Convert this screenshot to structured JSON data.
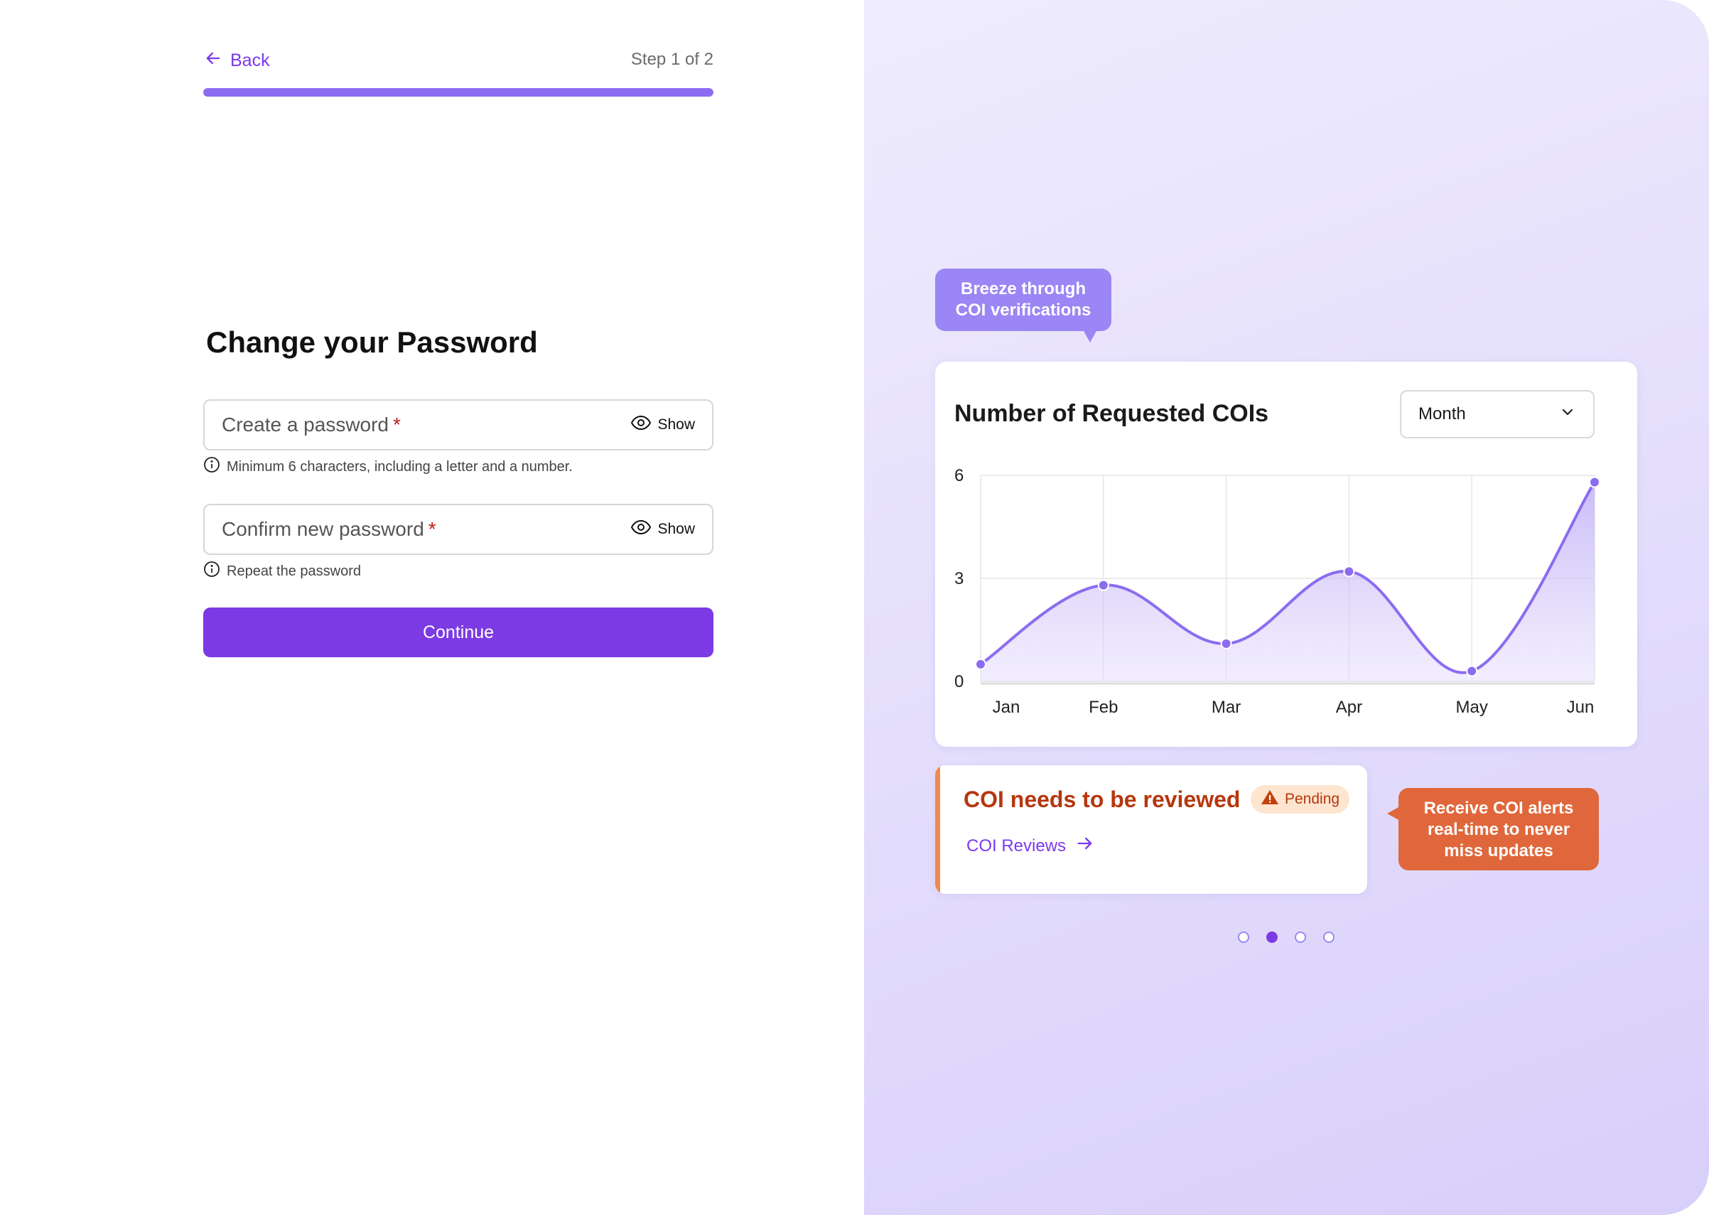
{
  "nav": {
    "back_label": "Back",
    "step_label": "Step 1 of 2",
    "progress": 1.0
  },
  "form": {
    "title": "Change your Password",
    "password_placeholder": "Create a password",
    "password_hint": "Minimum 6 characters, including a letter and a number.",
    "confirm_placeholder": "Confirm new password",
    "confirm_hint": "Repeat the password",
    "required_mark": "*",
    "show_label": "Show",
    "continue_label": "Continue"
  },
  "promo": {
    "bubble_top": [
      "Breeze through",
      "COI verifications"
    ],
    "chart_title": "Number of Requested COIs",
    "period_select": "Month",
    "alert_title": "COI needs to be reviewed",
    "alert_badge": "Pending",
    "alert_link": "COI Reviews",
    "bubble_side": [
      "Receive COI alerts",
      "real-time to never",
      "miss updates"
    ],
    "carousel_active_index": 1,
    "carousel_count": 4
  },
  "colors": {
    "accent": "#7c3ae5",
    "line": "#8b6cf0",
    "alert": "#b6370f",
    "bubble_orange": "#e0673b"
  },
  "chart_data": {
    "type": "area",
    "categories": [
      "Jan",
      "Feb",
      "Mar",
      "Apr",
      "May",
      "Jun"
    ],
    "values": [
      0.5,
      2.8,
      1.1,
      3.2,
      0.3,
      5.8
    ],
    "yticks": [
      0,
      3,
      6
    ],
    "ylim": [
      0,
      6
    ],
    "grid": true
  }
}
